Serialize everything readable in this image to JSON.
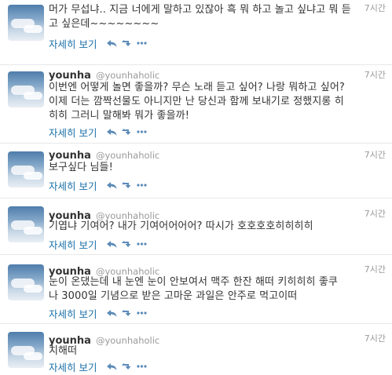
{
  "tweets": [
    {
      "name": "younha",
      "handle": "@younhaholic",
      "time": "7시간",
      "text": "머가 무섭냐.. 지금 너에게 말하고 있잖아 흑 뭐 하고 놀고 싶냐고 뭐 듣\n고 싶은데~~~~~~~~",
      "details": "자세히 보기"
    },
    {
      "name": "younha",
      "handle": "@younhaholic",
      "time": "7시간",
      "text": "이번엔 어떻게 놀면 좋을까? 무슨 노래 듣고 싶어? 나랑 뭐하고 싶어?\n이제 더는 깜짝선물도 아니지만 난 당신과 함께 보내기로 정했지롱 히\n히히 그러니 말해봐 뭐가 좋을까!",
      "details": "자세히 보기"
    },
    {
      "name": "younha",
      "handle": "@younhaholic",
      "time": "7시간",
      "text": "보구싶다 님들!",
      "details": "자세히 보기"
    },
    {
      "name": "younha",
      "handle": "@younhaholic",
      "time": "7시간",
      "text": "기엽냐 기여어? 내가 기여어어어어? 따시가 호호호호히히히히",
      "details": "자세히 보기"
    },
    {
      "name": "younha",
      "handle": "@younhaholic",
      "time": "7시간",
      "text": "눈이 온댔는데 내 눈엔 눈이 안보여서 맥주 한잔 해떠 키히히히 좋쿠\n나 3000일 기념으로 받은 고마운 과일은 안주로 먹고이떠",
      "details": "자세히 보기"
    },
    {
      "name": "younha",
      "handle": "@younhaholic",
      "time": "7시간",
      "text": "치해떠",
      "details": "자세히 보기"
    }
  ],
  "icons": [
    "reply-icon",
    "retweet-icon",
    "more-icon"
  ],
  "colors": {
    "link": "#1a6fa8",
    "meta": "#999999",
    "text": "#333333"
  }
}
